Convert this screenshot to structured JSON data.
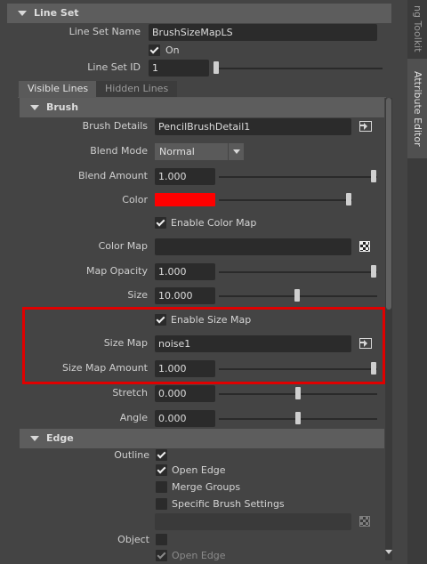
{
  "line_set_frame": {
    "title": "Line Set",
    "name_label": "Line Set Name",
    "name_value": "BrushSizeMapLS",
    "on_label": "On",
    "on_checked": true,
    "id_label": "Line Set ID",
    "id_value": "1"
  },
  "tabs": [
    {
      "label": "Visible Lines",
      "active": true
    },
    {
      "label": "Hidden Lines",
      "active": false
    }
  ],
  "brush": {
    "title": "Brush",
    "details_label": "Brush Details",
    "details_value": "PencilBrushDetail1",
    "blend_mode_label": "Blend Mode",
    "blend_mode_value": "Normal",
    "blend_amount_label": "Blend Amount",
    "blend_amount_value": "1.000",
    "color_label": "Color",
    "color_value": "#ff0000",
    "enable_color_map_label": "Enable Color Map",
    "color_map_label": "Color Map",
    "color_map_value": "",
    "map_opacity_label": "Map Opacity",
    "map_opacity_value": "1.000",
    "size_label": "Size",
    "size_value": "10.000",
    "enable_size_map_label": "Enable Size Map",
    "size_map_label": "Size Map",
    "size_map_value": "noise1",
    "size_map_amount_label": "Size Map Amount",
    "size_map_amount_value": "1.000",
    "stretch_label": "Stretch",
    "stretch_value": "0.000",
    "angle_label": "Angle",
    "angle_value": "0.000"
  },
  "edge": {
    "title": "Edge",
    "outline_label": "Outline",
    "open_edge_label": "Open Edge",
    "merge_groups_label": "Merge Groups",
    "specific_brush_label": "Specific Brush Settings",
    "object_label": "Object",
    "object_open_edge_label": "Open Edge"
  },
  "dock": {
    "toolkit_tab": "ng Toolkit",
    "attribute_editor_tab": "Attribute Editor"
  },
  "colors": {
    "highlight": "#e00000",
    "panel_bg": "#444444",
    "field_bg": "#2b2b2b"
  }
}
